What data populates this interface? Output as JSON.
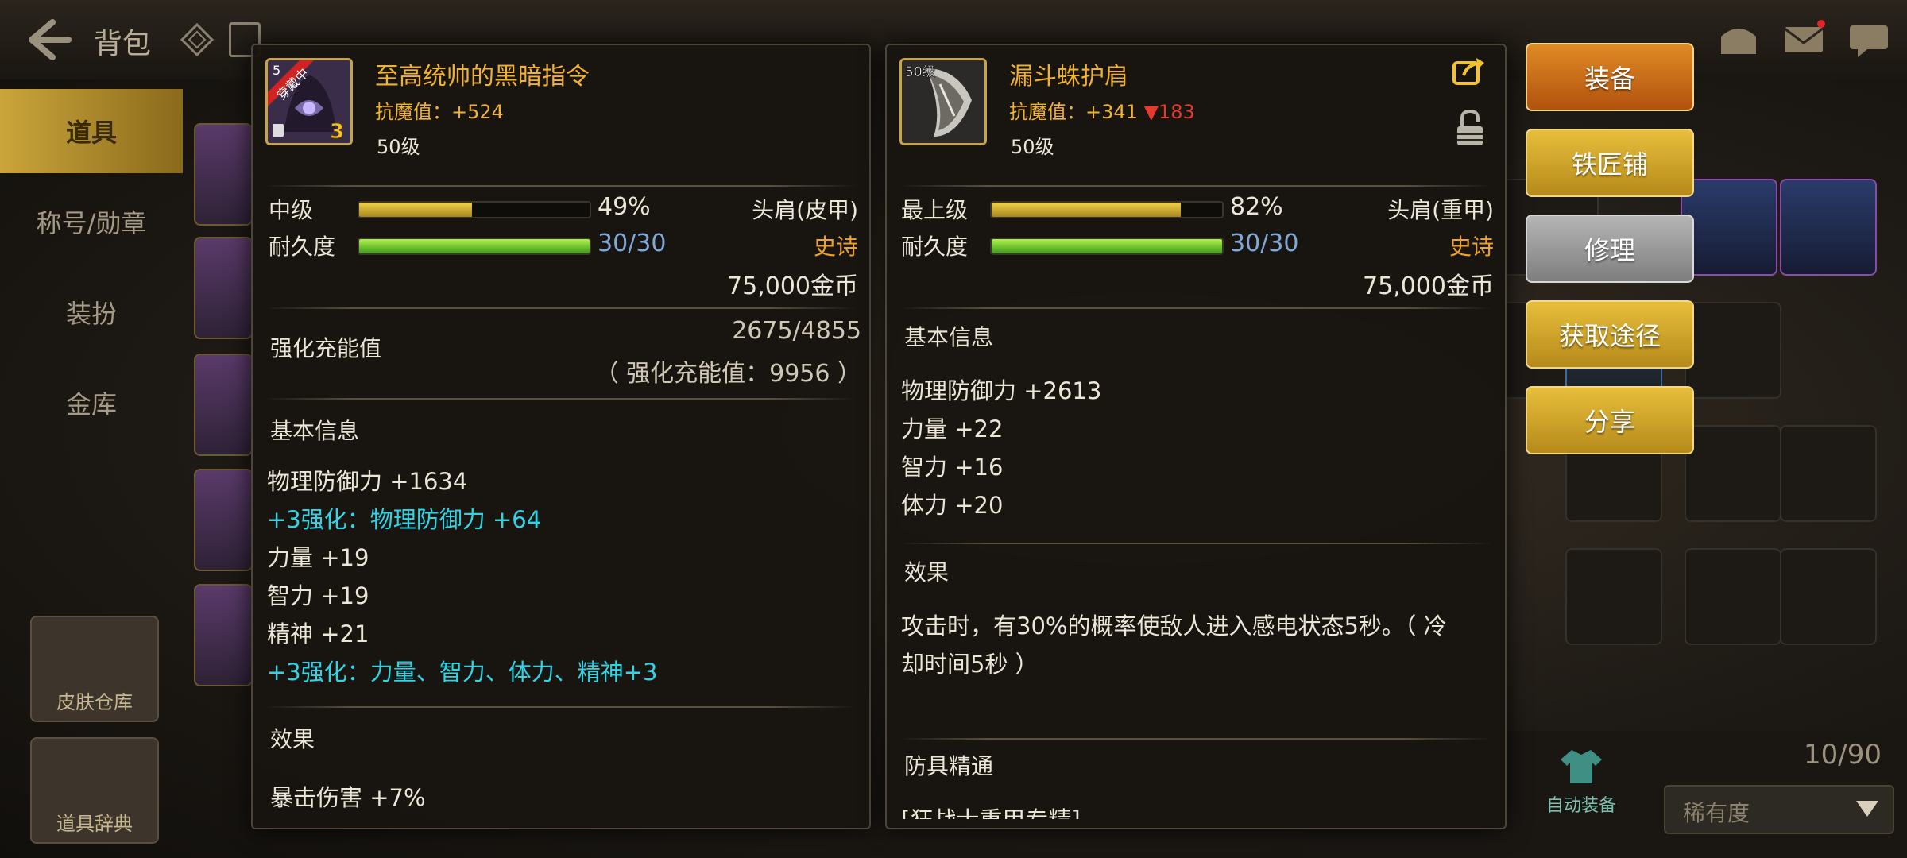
{
  "header": {
    "title": "背包"
  },
  "sidebar": {
    "tabs": [
      "道具",
      "称号/勋章",
      "装扮",
      "金库"
    ],
    "buttons": [
      "皮肤仓库",
      "道具辞典"
    ]
  },
  "inventory": {
    "count": "10/90",
    "sort_label": "稀有度",
    "auto_equip_label": "自动装备"
  },
  "left_item": {
    "badge_text": "穿戴中",
    "level_tag": "5",
    "enhance_badge": "3",
    "name": "至高统帅的黑暗指令",
    "resist_stat": "抗魔值：+524",
    "level": "50级",
    "grade_label": "中级",
    "grade_pct_value": 0.49,
    "grade_pct_text": "49%",
    "durability_label": "耐久度",
    "durability_text": "30/30",
    "durability_fill": 1.0,
    "type": "头肩(皮甲)",
    "rarity": "史诗",
    "price": "75,000金币",
    "charge_label": "强化充能值",
    "charge_value": "2675/4855",
    "charge_sub": "（ 强化充能值：9956 ）",
    "basic_info_title": "基本信息",
    "basic_lines": [
      {
        "text": "物理防御力 +1634",
        "cyan": false
      },
      {
        "text": "+3强化：物理防御力 +64",
        "cyan": true
      },
      {
        "text": "力量 +19",
        "cyan": false
      },
      {
        "text": "智力 +19",
        "cyan": false
      },
      {
        "text": "精神 +21",
        "cyan": false
      },
      {
        "text": "+3强化：力量、智力、体力、精神+3",
        "cyan": true
      }
    ],
    "effect_title": "效果",
    "effect_line": "暴击伤害 +7%"
  },
  "right_item": {
    "level_tag": "50级",
    "name": "漏斗蛛护肩",
    "resist_stat": "抗魔值：+341",
    "resist_diff": "▼183",
    "level": "50级",
    "grade_label": "最上级",
    "grade_pct_value": 0.82,
    "grade_pct_text": "82%",
    "durability_label": "耐久度",
    "durability_text": "30/30",
    "durability_fill": 1.0,
    "type": "头肩(重甲)",
    "rarity": "史诗",
    "price": "75,000金币",
    "basic_info_title": "基本信息",
    "basic_lines": [
      "物理防御力 +2613",
      "力量 +22",
      "智力 +16",
      "体力 +20"
    ],
    "effect_title": "效果",
    "effect_text_1": "攻击时，有30%的概率使敌人进入感电状态5秒。（ 冷",
    "effect_text_2": "却时间5秒 ）",
    "mastery_title": "防具精通",
    "mastery_cut": "[狂战士重甲专精]"
  },
  "actions": [
    "装备",
    "铁匠铺",
    "修理",
    "获取途径",
    "分享"
  ],
  "colors": {
    "gold_text": "#f2b22e",
    "cyan_text": "#2fd4e6",
    "rarity_epic": "#f2a12a",
    "durability_blue": "#7fa8d8"
  }
}
